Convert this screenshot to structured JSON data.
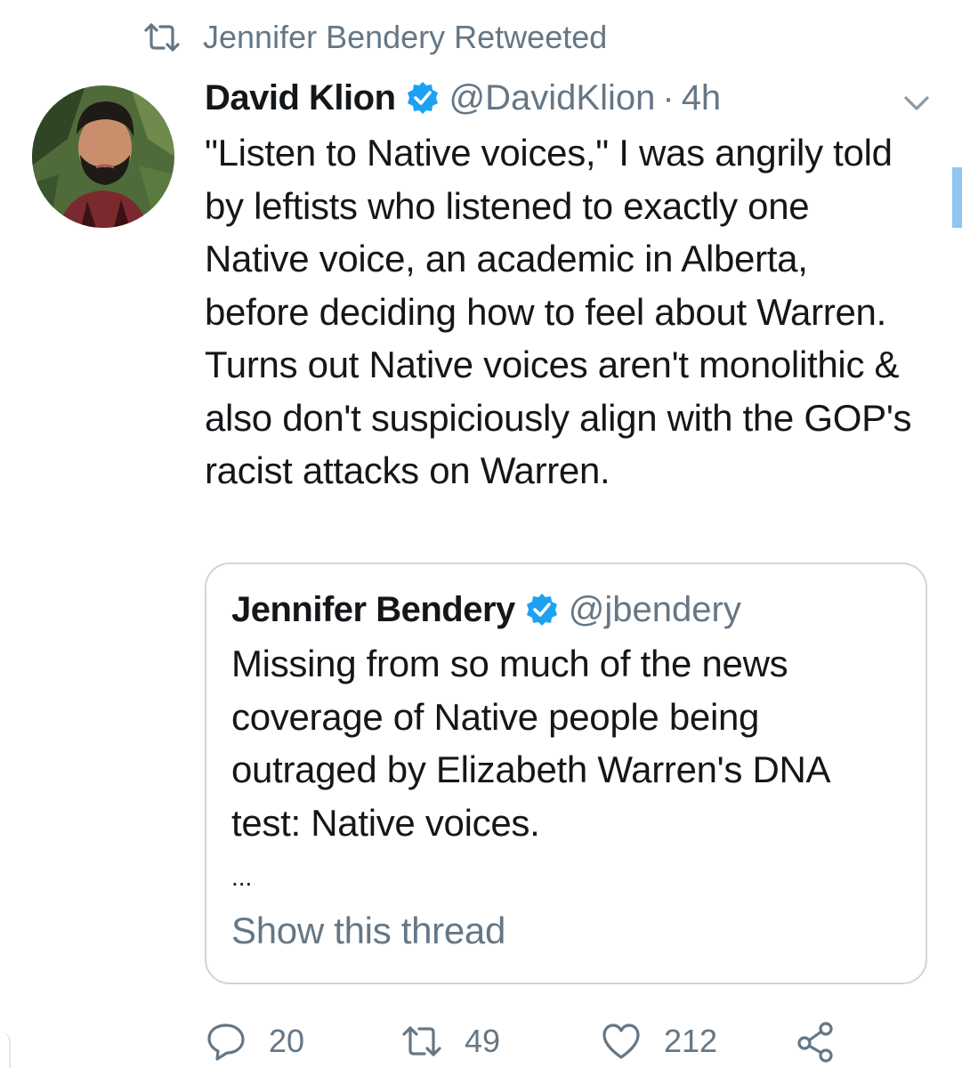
{
  "retweet_context": {
    "icon": "retweet-icon",
    "text": "Jennifer Bendery Retweeted"
  },
  "tweet": {
    "author_name": "David Klion",
    "verified": true,
    "handle": "@DavidKlion",
    "separator": "·",
    "time": "4h",
    "text": "\"Listen to Native voices,\" I was angrily told by leftists who listened to exactly one Native voice, an academic in Alberta, before deciding how to feel about Warren. Turns out Native voices aren't monolithic & also don't suspiciously align with the GOP's racist attacks on Warren."
  },
  "quote": {
    "author_name": "Jennifer Bendery",
    "verified": true,
    "handle": "@jbendery",
    "text": "Missing from so much of the news coverage of Native people being outraged by Elizabeth Warren's DNA test: Native voices.",
    "ellipsis": "...",
    "show_thread": "Show this thread"
  },
  "actions": {
    "replies": "20",
    "retweets": "49",
    "likes": "212"
  },
  "colors": {
    "text": "#14171a",
    "secondary": "#657786",
    "verified_blue": "#1da1f2",
    "border": "#ccd6dd"
  }
}
